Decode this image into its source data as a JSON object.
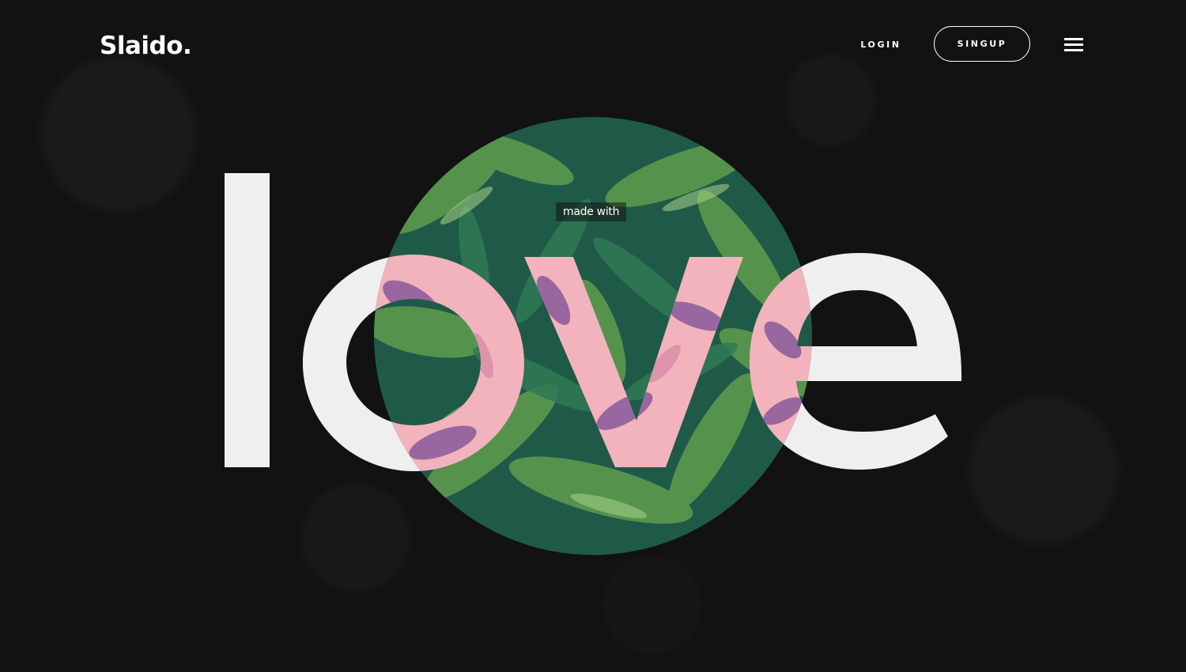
{
  "brand": {
    "logo_text": "Slaido."
  },
  "nav": {
    "login_label": "LOGIN",
    "signup_label": "SINGUP",
    "menu_icon": "hamburger-menu-icon"
  },
  "hero": {
    "tagline": "made with",
    "headline": "love"
  },
  "colors": {
    "background": "#111111",
    "text": "#ffffff",
    "letters": "#efefef",
    "foliage_dark": "#1f5a48",
    "foliage_light": "#5c9a4e",
    "flower_pink": "#f2b3bd",
    "flower_purple": "#8a5a9a"
  }
}
